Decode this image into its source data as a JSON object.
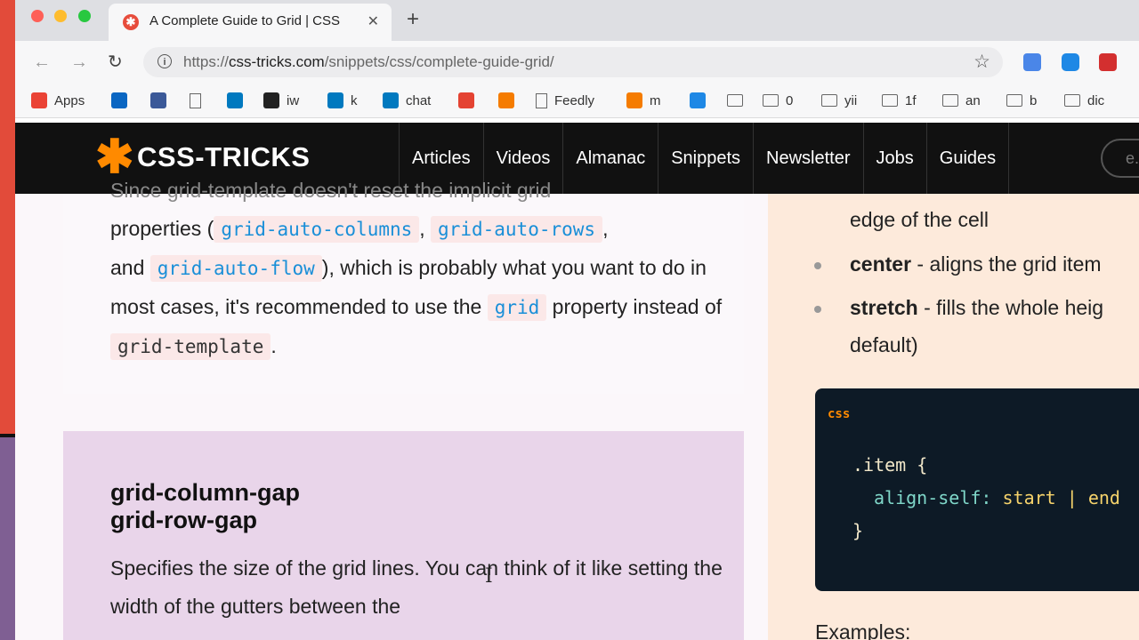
{
  "browser": {
    "tab_title": "A Complete Guide to Grid | CSS",
    "tab_favicon": "✱",
    "tab_close": "✕",
    "new_tab": "+",
    "url_scheme": "https://",
    "url_host": "css-tricks.com",
    "url_path": "/snippets/css/complete-guide-grid/",
    "info_glyph": "i",
    "star_glyph": "☆",
    "back_glyph": "←",
    "forward_glyph": "→",
    "reload_glyph": "↻"
  },
  "bookmarks": [
    {
      "label": "Apps",
      "icon": "apps-grid-icon"
    },
    {
      "label": "",
      "icon": "linkedin-icon"
    },
    {
      "label": "",
      "icon": "facebook-icon"
    },
    {
      "label": "",
      "icon": "page-icon"
    },
    {
      "label": "",
      "icon": "trello-icon"
    },
    {
      "label": "iw",
      "icon": "instapaper-icon"
    },
    {
      "label": "k",
      "icon": "trello-icon"
    },
    {
      "label": "chat",
      "icon": "trello-icon"
    },
    {
      "label": "",
      "icon": "todoist-icon"
    },
    {
      "label": "",
      "icon": "arrow-icon"
    },
    {
      "label": "Feedly",
      "icon": "page-icon"
    },
    {
      "label": "m",
      "icon": "arrow-icon"
    },
    {
      "label": "",
      "icon": "d-icon"
    },
    {
      "label": "",
      "icon": "folder-icon"
    },
    {
      "label": "0",
      "icon": "folder-icon"
    },
    {
      "label": "yii",
      "icon": "folder-icon"
    },
    {
      "label": "1f",
      "icon": "folder-icon"
    },
    {
      "label": "an",
      "icon": "folder-icon"
    },
    {
      "label": "b",
      "icon": "folder-icon"
    },
    {
      "label": "dic",
      "icon": "folder-icon"
    }
  ],
  "site": {
    "logo_star": "✱",
    "logo_text": "CSS-TRICKS",
    "nav": [
      "Articles",
      "Videos",
      "Almanac",
      "Snippets",
      "Newsletter",
      "Jobs",
      "Guides"
    ],
    "search_placeholder": "e."
  },
  "left": {
    "p1_top_partial": "Since grid-template doesn't reset the implicit grid",
    "p1_a": "properties (",
    "code_auto_columns": "grid-auto-columns",
    "comma": ",",
    "code_auto_rows": "grid-auto-rows",
    "p1_b": "and",
    "code_auto_flow": "grid-auto-flow",
    "p1_c": "), which is probably what you want to do in most cases, it's recommended to use the",
    "code_grid": "grid",
    "p1_d": "property instead of",
    "code_grid_template": "grid-template",
    "period": ".",
    "h3_line1": "grid-column-gap",
    "h3_line2": "grid-row-gap",
    "p2": "Specifies the size of the grid lines. You can think of it like setting the width of the gutters between the"
  },
  "right": {
    "top_partial": "edge of the cell",
    "center_bold": "center",
    "center_rest": " - aligns the grid item",
    "stretch_bold": "stretch",
    "stretch_rest": " - fills the whole heig",
    "stretch_cont": "default)",
    "code_lang": "css",
    "code_line1": ".item {",
    "code_line2_prop": "align-self:",
    "code_line2_val": " start | end",
    "code_line3": "}",
    "examples": "Examples:"
  },
  "colors": {
    "accent": "#ff8a00",
    "code_blue": "#1a8fd8"
  }
}
